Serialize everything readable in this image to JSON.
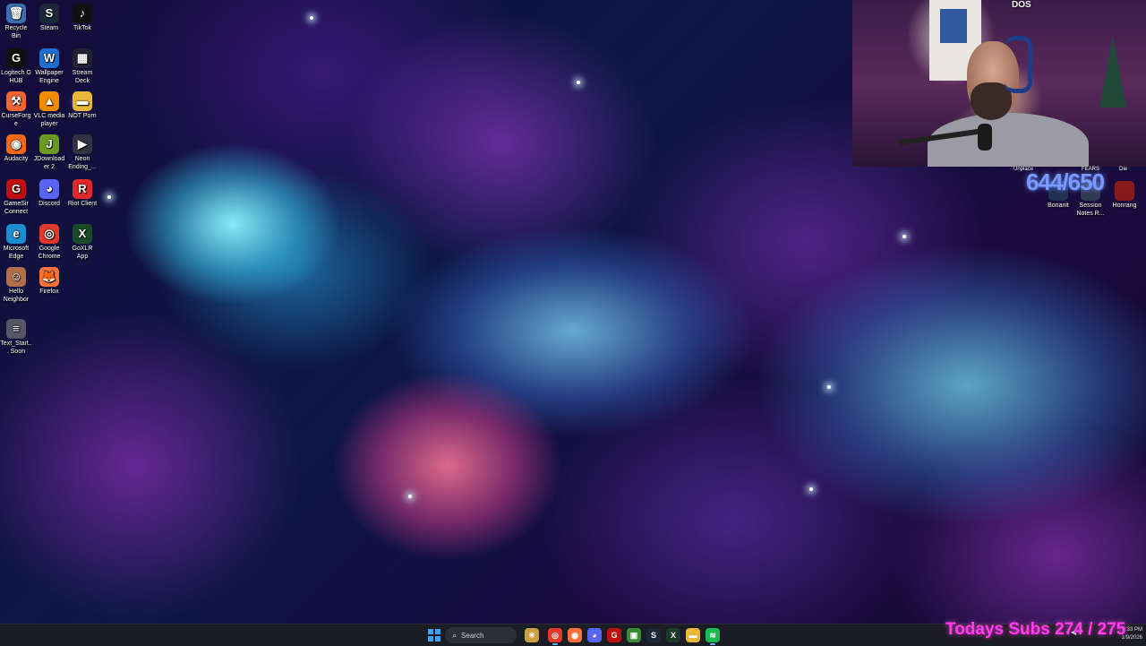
{
  "desktop": {
    "icons": [
      {
        "label": "Recycle Bin",
        "icon": "recycle-bin-icon",
        "color": "#3a6fb0",
        "glyph": "🗑"
      },
      {
        "label": "Steam",
        "icon": "steam-icon",
        "color": "#1b2838",
        "glyph": "S"
      },
      {
        "label": "TikTok",
        "icon": "tiktok-icon",
        "color": "#111111",
        "glyph": "♪"
      },
      {
        "label": "Logitech G HUB",
        "icon": "logitech-icon",
        "color": "#111111",
        "glyph": "G"
      },
      {
        "label": "Wallpaper Engine",
        "icon": "wallpaper-engine-icon",
        "color": "#1f6fd0",
        "glyph": "W"
      },
      {
        "label": "Stream Deck",
        "icon": "stream-deck-icon",
        "color": "#222233",
        "glyph": "▦"
      },
      {
        "label": "CurseForge",
        "icon": "curseforge-icon",
        "color": "#f16436",
        "glyph": "⚒"
      },
      {
        "label": "VLC media player",
        "icon": "vlc-icon",
        "color": "#f08a00",
        "glyph": "▲"
      },
      {
        "label": "NOT Porn",
        "icon": "folder-icon",
        "color": "#e8b73a",
        "glyph": "▬"
      },
      {
        "label": "Audacity",
        "icon": "audacity-icon",
        "color": "#f06a1a",
        "glyph": "◉"
      },
      {
        "label": "JDownloader 2",
        "icon": "jdownloader-icon",
        "color": "#6a9a20",
        "glyph": "J"
      },
      {
        "label": "Neon Ending_...",
        "icon": "video-file-icon",
        "color": "#333344",
        "glyph": "▶"
      },
      {
        "label": "GameSir Connect",
        "icon": "gamesir-icon",
        "color": "#c01010",
        "glyph": "G"
      },
      {
        "label": "Discord",
        "icon": "discord-icon",
        "color": "#5865f2",
        "glyph": "◕"
      },
      {
        "label": "Riot Client",
        "icon": "riot-client-icon",
        "color": "#e0282a",
        "glyph": "R"
      },
      {
        "label": "Microsoft Edge",
        "icon": "edge-icon",
        "color": "#1b8fd0",
        "glyph": "e"
      },
      {
        "label": "Google Chrome",
        "icon": "chrome-icon",
        "color": "#e0392b",
        "glyph": "◎"
      },
      {
        "label": "GoXLR App",
        "icon": "goxlr-icon",
        "color": "#1a4a2a",
        "glyph": "X"
      },
      {
        "label": "Hello Neighbor",
        "icon": "hello-neighbor-icon",
        "color": "#b0704a",
        "glyph": "☺"
      },
      {
        "label": "Firefox",
        "icon": "firefox-icon",
        "color": "#ff7139",
        "glyph": "🦊"
      },
      {
        "label": "Text_Start... Soon",
        "icon": "text-file-icon",
        "color": "#555566",
        "glyph": "≡"
      }
    ],
    "right_icons": [
      {
        "label": "Bonanit",
        "icon": "app-icon",
        "color": "#203050"
      },
      {
        "label": "Session Notes R...",
        "icon": "notes-icon",
        "color": "#303a50"
      },
      {
        "label": "Honrang",
        "icon": "game-icon",
        "color": "#8a1a1a"
      }
    ],
    "right_small_labels": [
      "Unplace",
      "FEARS",
      "Die"
    ]
  },
  "webcam": {
    "overlay_text": "DOS"
  },
  "stream_overlay": {
    "counter": "644/650",
    "subs_text": "Todays Subs 274 / 275"
  },
  "taskbar": {
    "search_placeholder": "Search",
    "pinned": [
      {
        "name": "widgets-icon",
        "color": "#c8a040",
        "glyph": "☀"
      },
      {
        "name": "chrome-taskbar-icon",
        "color": "#e0392b",
        "glyph": "◎"
      },
      {
        "name": "firefox-taskbar-icon",
        "color": "#ff7139",
        "glyph": "◉"
      },
      {
        "name": "discord-taskbar-icon",
        "color": "#5865f2",
        "glyph": "◕"
      },
      {
        "name": "gamesir-taskbar-icon",
        "color": "#c01010",
        "glyph": "G"
      },
      {
        "name": "editor-taskbar-icon",
        "color": "#3a8a3a",
        "glyph": "▣"
      },
      {
        "name": "steam-taskbar-icon",
        "color": "#1b2838",
        "glyph": "S"
      },
      {
        "name": "goxlr-taskbar-icon",
        "color": "#1a3a2a",
        "glyph": "X"
      },
      {
        "name": "file-explorer-icon",
        "color": "#e8b73a",
        "glyph": "▬"
      },
      {
        "name": "spotify-icon",
        "color": "#1db954",
        "glyph": "≋"
      }
    ],
    "clock_time": "2:33 PM",
    "clock_date": "1/9/2026"
  }
}
